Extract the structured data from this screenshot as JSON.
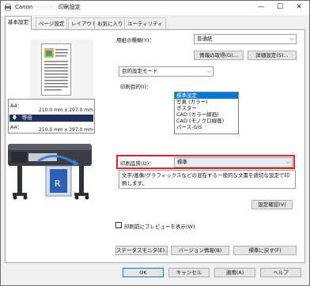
{
  "window": {
    "title": "Canon  印刷設定",
    "title_blur": "〇〇〇〇",
    "minimize": "—",
    "maximize": "☐",
    "close": "✕"
  },
  "tabs": [
    {
      "label": "基本設定",
      "active": true
    },
    {
      "label": "ページ設定",
      "active": false
    },
    {
      "label": "レイアウト",
      "active": false
    },
    {
      "label": "お気に入り",
      "active": false
    },
    {
      "label": "ユーティリティ",
      "active": false
    }
  ],
  "paper_type": {
    "label": "用紙の種類(Y)：",
    "value": "普通紙"
  },
  "buttons": {
    "get_info": "情報の取得(G)...",
    "detail_settings": "詳細設定(S)...",
    "quality_confirm": "設定確認(V)",
    "status_monitor": "ステータスモニタ(E)...",
    "version_info": "バージョン情報(B)",
    "restore_default": "標準に戻す(F)",
    "ok": "OK",
    "cancel": "キャンセル",
    "apply": "適用(A)",
    "help": "ヘルプ"
  },
  "mode": {
    "value": "目的設定モード"
  },
  "purpose": {
    "label": "印刷目的(I)：",
    "items": [
      "標準設定",
      "写真 (カラー)",
      "ポスター",
      "CAD (カラー線画)",
      "CAD (モノクロ線画)",
      "パース-GIS"
    ],
    "selected_index": 0
  },
  "quality": {
    "label": "印刷品質(Q)：",
    "value": "標準",
    "description": "文字/画像/グラフィックスなどの混在する一般的な文書を適切な設定で印刷します。"
  },
  "preview_checkbox": {
    "label": "印刷前にプレビューを表示(W)",
    "checked": false
  },
  "sizes": {
    "input_label": "A4：",
    "input_dims": "210.0 mm x 297.0 mm",
    "scale": "等倍",
    "output_label": "A4：",
    "output_dims": "210.0 mm x 297.0 mm"
  },
  "colors": {
    "highlight": "#e0242a",
    "selection": "#0078d7",
    "size_bar": "#1e2f5e"
  }
}
